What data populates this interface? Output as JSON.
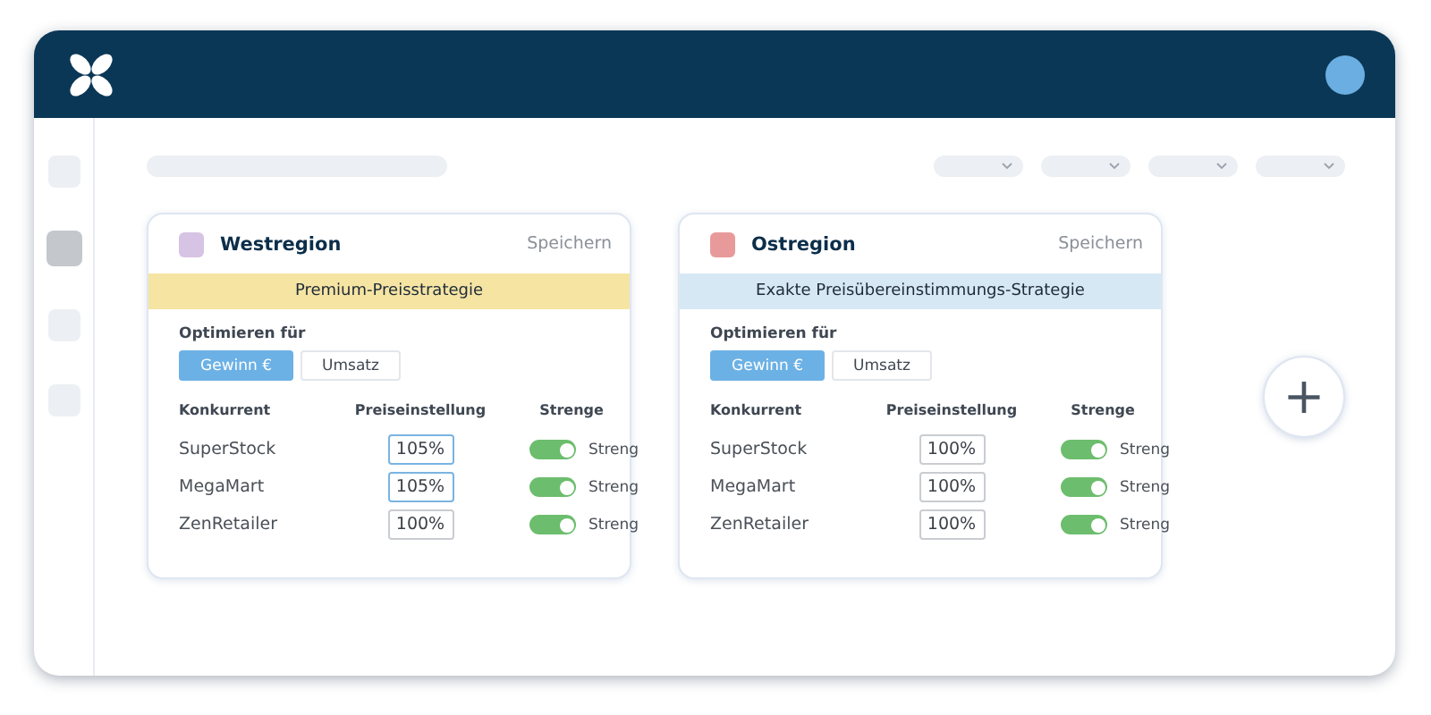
{
  "sidebar": {
    "items": [
      {
        "selected": false
      },
      {
        "selected": true
      },
      {
        "selected": false
      },
      {
        "selected": false
      }
    ]
  },
  "cards": [
    {
      "title": "Westregion",
      "color": "#d7c3e3",
      "save": "Speichern",
      "strategy": {
        "label": "Premium-Preisstrategie",
        "color": "#f6e4a3"
      },
      "optimize_label": "Optimieren für",
      "options": [
        {
          "label": "Gewinn €",
          "selected": true
        },
        {
          "label": "Umsatz",
          "selected": false
        }
      ],
      "columns": [
        "Konkurrent",
        "Preiseinstellung",
        "Strenge"
      ],
      "rows": [
        {
          "name": "SuperStock",
          "value": "105%",
          "highlighted": true,
          "on": true,
          "strict": "Streng"
        },
        {
          "name": "MegaMart",
          "value": "105%",
          "highlighted": true,
          "on": true,
          "strict": "Streng"
        },
        {
          "name": "ZenRetailer",
          "value": "100%",
          "highlighted": false,
          "on": true,
          "strict": "Streng"
        }
      ]
    },
    {
      "title": "Ostregion",
      "color": "#e89a9a",
      "save": "Speichern",
      "strategy": {
        "label": "Exakte Preisübereinstimmungs-Strategie",
        "color": "#d7e8f5"
      },
      "optimize_label": "Optimieren für",
      "options": [
        {
          "label": "Gewinn €",
          "selected": true
        },
        {
          "label": "Umsatz",
          "selected": false
        }
      ],
      "columns": [
        "Konkurrent",
        "Preiseinstellung",
        "Strenge"
      ],
      "rows": [
        {
          "name": "SuperStock",
          "value": "100%",
          "highlighted": false,
          "on": true,
          "strict": "Streng"
        },
        {
          "name": "MegaMart",
          "value": "100%",
          "highlighted": false,
          "on": true,
          "strict": "Streng"
        },
        {
          "name": "ZenRetailer",
          "value": "100%",
          "highlighted": false,
          "on": true,
          "strict": "Streng"
        }
      ]
    }
  ],
  "add_button": "+"
}
